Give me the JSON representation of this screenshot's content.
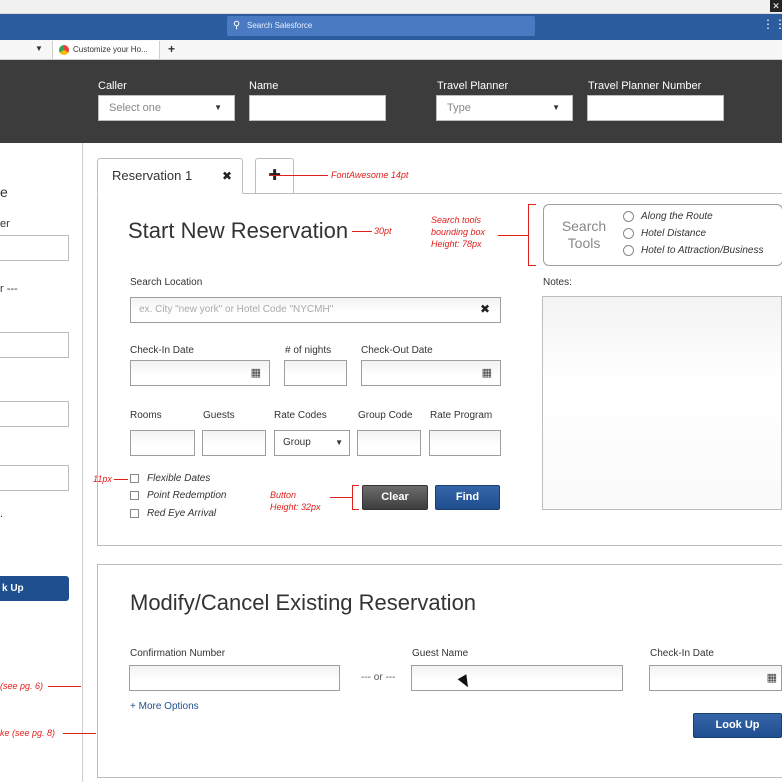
{
  "browser": {
    "search_placeholder": "Search Salesforce",
    "tab_title": "Customize your Ho...",
    "close_glyph": "✕",
    "grid_glyph": "⋮⋮⋮",
    "new_tab_glyph": "+"
  },
  "caller_bar": {
    "caller_label": "Caller",
    "caller_value": "Select one",
    "name_label": "Name",
    "name_value": "",
    "travel_planner_label": "Travel Planner",
    "travel_planner_value": "Type",
    "travel_planner_number_label": "Travel Planner Number",
    "travel_planner_number_value": ""
  },
  "left_panel": {
    "heading_fragment": "e",
    "label_fragment": "er",
    "dash_fragment": "r ---",
    "dot_fragment": ".",
    "button_fragment": "k Up"
  },
  "tabs": {
    "reservation_label": "Reservation 1",
    "close_glyph": "✖",
    "add_glyph": "✚"
  },
  "reservation": {
    "title": "Start New Reservation",
    "search_location_label": "Search Location",
    "search_location_placeholder": "ex. City \"new york\" or Hotel Code \"NYCMH\"",
    "clear_glyph": "✖",
    "check_in_label": "Check-In Date",
    "nights_label": "# of nights",
    "check_out_label": "Check-Out Date",
    "rooms_label": "Rooms",
    "guests_label": "Guests",
    "rate_codes_label": "Rate Codes",
    "rate_codes_value": "Group",
    "group_code_label": "Group Code",
    "rate_program_label": "Rate Program",
    "checkboxes": [
      "Flexible Dates",
      "Point Redemption",
      "Red Eye Arrival"
    ],
    "clear_button": "Clear",
    "find_button": "Find",
    "calendar_glyph": "▦"
  },
  "search_tools": {
    "title_line1": "Search",
    "title_line2": "Tools",
    "options": [
      "Along the Route",
      "Hotel Distance",
      "Hotel to Attraction/Business"
    ]
  },
  "notes": {
    "label": "Notes:"
  },
  "annotations": {
    "fontawesome": "FontAwesome 14pt",
    "title_size": "30pt",
    "search_tools_box": "Search tools\nbounding box\nHeight: 78px",
    "checkbox_size": "11px",
    "button_height": "Button\nHeight: 32px",
    "see_pg6": "(see pg. 6)",
    "see_pg8": "ke (see pg. 8)"
  },
  "modify": {
    "title": "Modify/Cancel Existing Reservation",
    "confirmation_label": "Confirmation Number",
    "or_separator": "--- or ---",
    "guest_name_label": "Guest Name",
    "check_in_label": "Check-In Date",
    "more_options": "+ More Options",
    "lookup_button": "Look Up"
  },
  "colors": {
    "salesforce_blue": "#2b5c9e",
    "dark_bar": "#3c3c3c",
    "primary_button": "#1f4f8f",
    "annotation_red": "#e0201b"
  }
}
